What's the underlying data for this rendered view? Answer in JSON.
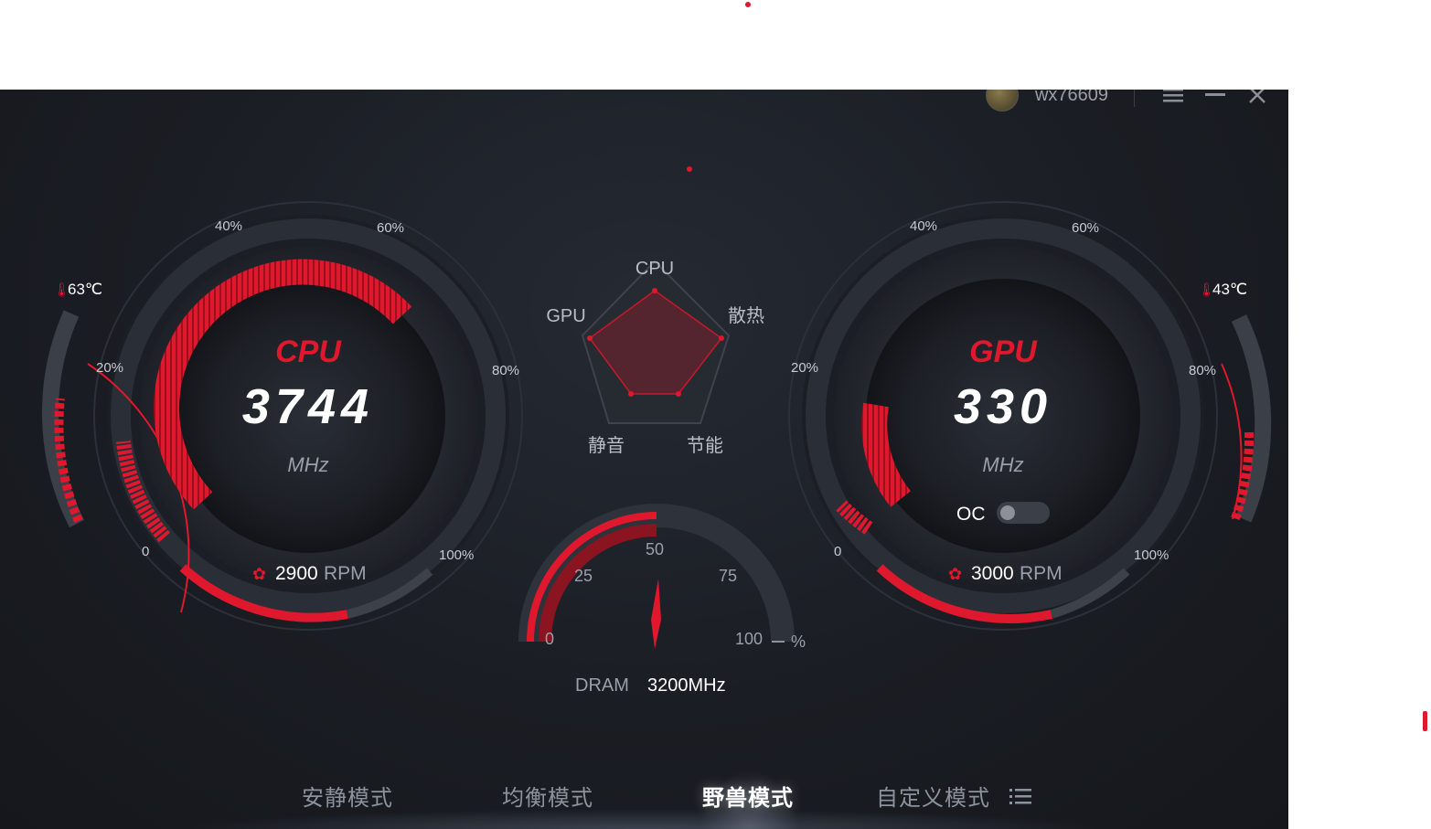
{
  "topbar": {
    "username": "wx76609",
    "menu_icon": "menu-icon",
    "minimize_icon": "minimize-icon",
    "close_icon": "close-icon"
  },
  "cpu_gauge": {
    "title": "CPU",
    "value": "3744",
    "unit": "MHz",
    "temperature": "63℃",
    "fan_rpm": "2900",
    "fan_unit": "RPM",
    "scale": {
      "p0": "0",
      "p20": "20%",
      "p40": "40%",
      "p60": "60%",
      "p80": "80%",
      "p100": "100%"
    }
  },
  "gpu_gauge": {
    "title": "GPU",
    "value": "330",
    "unit": "MHz",
    "temperature": "43℃",
    "fan_rpm": "3000",
    "fan_unit": "RPM",
    "oc_label": "OC",
    "oc_enabled": false,
    "scale": {
      "p0": "0",
      "p20": "20%",
      "p40": "40%",
      "p60": "60%",
      "p80": "80%",
      "p100": "100%"
    }
  },
  "radar": {
    "labels": {
      "top": "CPU",
      "left": "GPU",
      "right": "散热",
      "bottom_left": "静音",
      "bottom_right": "节能"
    }
  },
  "dram_gauge": {
    "ticks": {
      "t0": "0",
      "t25": "25",
      "t50": "50",
      "t75": "75",
      "t100": "100"
    },
    "unit": "%",
    "label": "DRAM",
    "value": "3200MHz"
  },
  "modes": {
    "quiet": "安静模式",
    "balanced": "均衡模式",
    "beast": "野兽模式",
    "custom": "自定义模式",
    "active": "beast"
  },
  "colors": {
    "accent": "#e0182d",
    "background": "#1a1d23",
    "text_muted": "#8d939c"
  }
}
